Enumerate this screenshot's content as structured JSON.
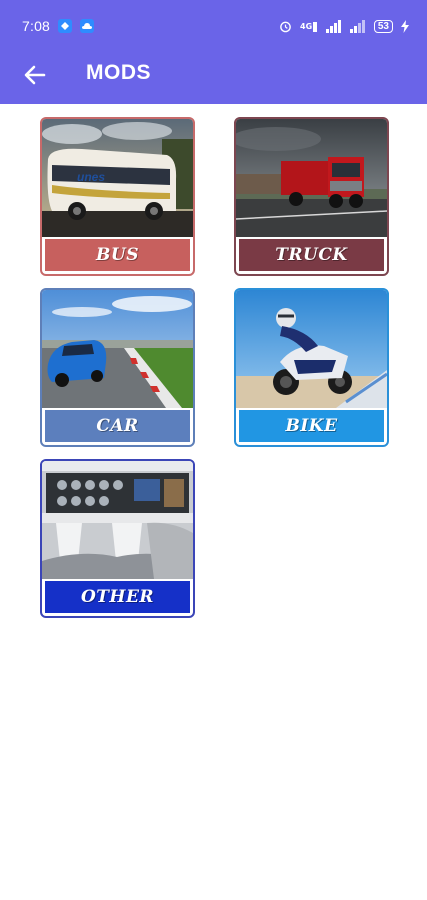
{
  "status_bar": {
    "time": "7:08",
    "icons": [
      "app-notification-icon",
      "cloud-icon"
    ],
    "right_icons": [
      "alarm-icon",
      "signal-4g-icon",
      "signal-bars-icon",
      "signal-bars-icon",
      "battery-icon",
      "charging-bolt-icon"
    ],
    "battery": "53"
  },
  "header": {
    "title": "MODS",
    "back_icon": "arrow-left-icon",
    "color": "#6a64e8"
  },
  "categories": [
    {
      "label": "BUS",
      "label_color": "#c7605e",
      "border_color": "#c76a6a"
    },
    {
      "label": "TRUCK",
      "label_color": "#7a3a45",
      "border_color": "#7d4650"
    },
    {
      "label": "CAR",
      "label_color": "#5c7fbd",
      "border_color": "#5e7fb8"
    },
    {
      "label": "BIKE",
      "label_color": "#2196e3",
      "border_color": "#2a90d8"
    },
    {
      "label": "OTHER",
      "label_color": "#1530c8",
      "border_color": "#3b45b7"
    }
  ]
}
